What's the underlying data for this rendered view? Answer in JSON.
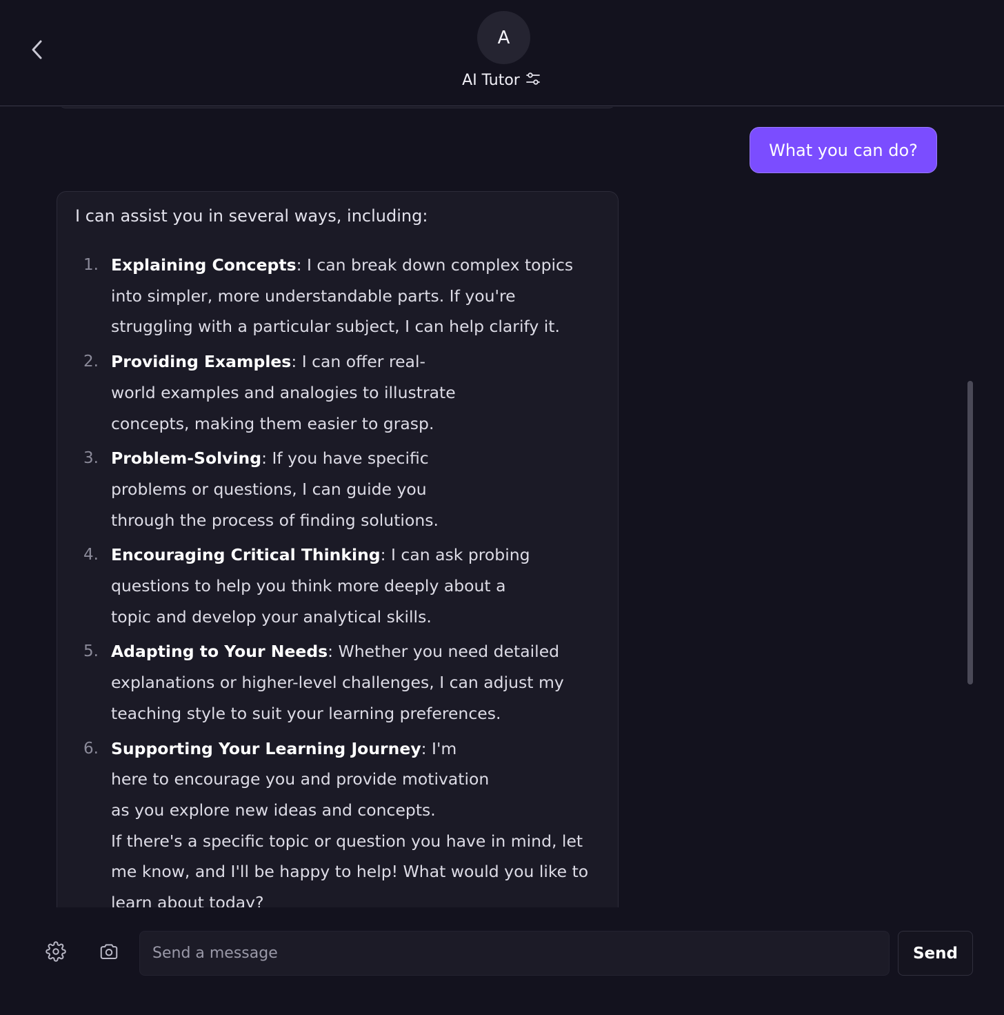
{
  "header": {
    "avatar_letter": "A",
    "title": "AI Tutor",
    "back_icon": "chevron-left-icon",
    "settings_icon": "sliders-icon"
  },
  "messages": {
    "user": {
      "text": "What you can do?"
    },
    "assistant": {
      "intro": "I can assist you in several ways, including:",
      "items": [
        {
          "num": "1.",
          "title": "Explaining Concepts",
          "text": ": I can break down complex topics into simpler, more understandable parts. If you're struggling with a particular subject, I can help clarify it."
        },
        {
          "num": "2.",
          "title": "Providing Examples",
          "text": ": I can offer real-world examples and analogies to illustrate concepts, making them easier to grasp."
        },
        {
          "num": "3.",
          "title": "Problem-Solving",
          "text": ": If you have specific problems or questions, I can guide you through the process of finding solutions."
        },
        {
          "num": "4.",
          "title": "Encouraging Critical Thinking",
          "text": ": I can ask probing questions to help you think more deeply about a topic and develop your analytical skills."
        },
        {
          "num": "5.",
          "title": "Adapting to Your Needs",
          "text": ": Whether you need detailed explanations or higher-level challenges, I can adjust my teaching style to suit your learning preferences."
        },
        {
          "num": "6.",
          "title": "Supporting Your Learning Journey",
          "text": ": I'm here to encourage you and provide motivation as you explore new ideas and concepts."
        }
      ],
      "closing": "If there's a specific topic or question you have in mind, let me know, and I'll be happy to help! What would you like to learn about today?"
    }
  },
  "composer": {
    "placeholder": "Send a message",
    "send_label": "Send",
    "settings_icon": "gear-icon",
    "camera_icon": "camera-icon"
  },
  "colors": {
    "background": "#13121e",
    "accent": "#7b4dff",
    "bubble": "#1b1a26"
  }
}
